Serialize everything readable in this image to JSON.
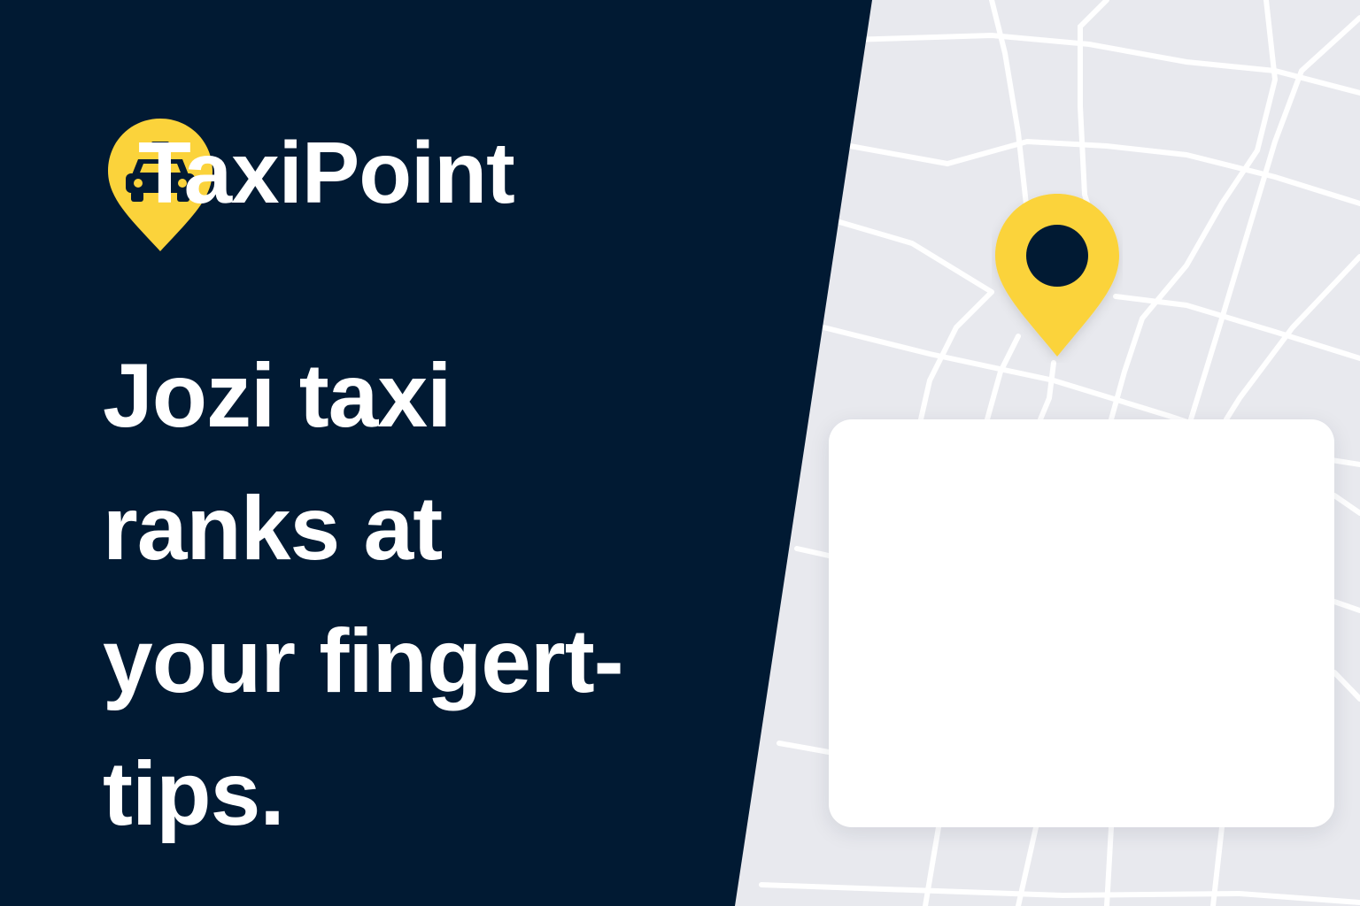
{
  "brand": {
    "name": "TaxiPoint",
    "logo_icon": "taxi-pin-icon"
  },
  "headline": {
    "lines": [
      "Jozi taxi",
      "ranks at",
      "your fingert-",
      "tips."
    ]
  },
  "map": {
    "marker_icon": "location-pin-icon"
  },
  "colors": {
    "navy": "#011a33",
    "accent_yellow": "#fbd33b",
    "map_background": "#e8e9ee",
    "map_roads": "#ffffff",
    "card": "#ffffff"
  }
}
